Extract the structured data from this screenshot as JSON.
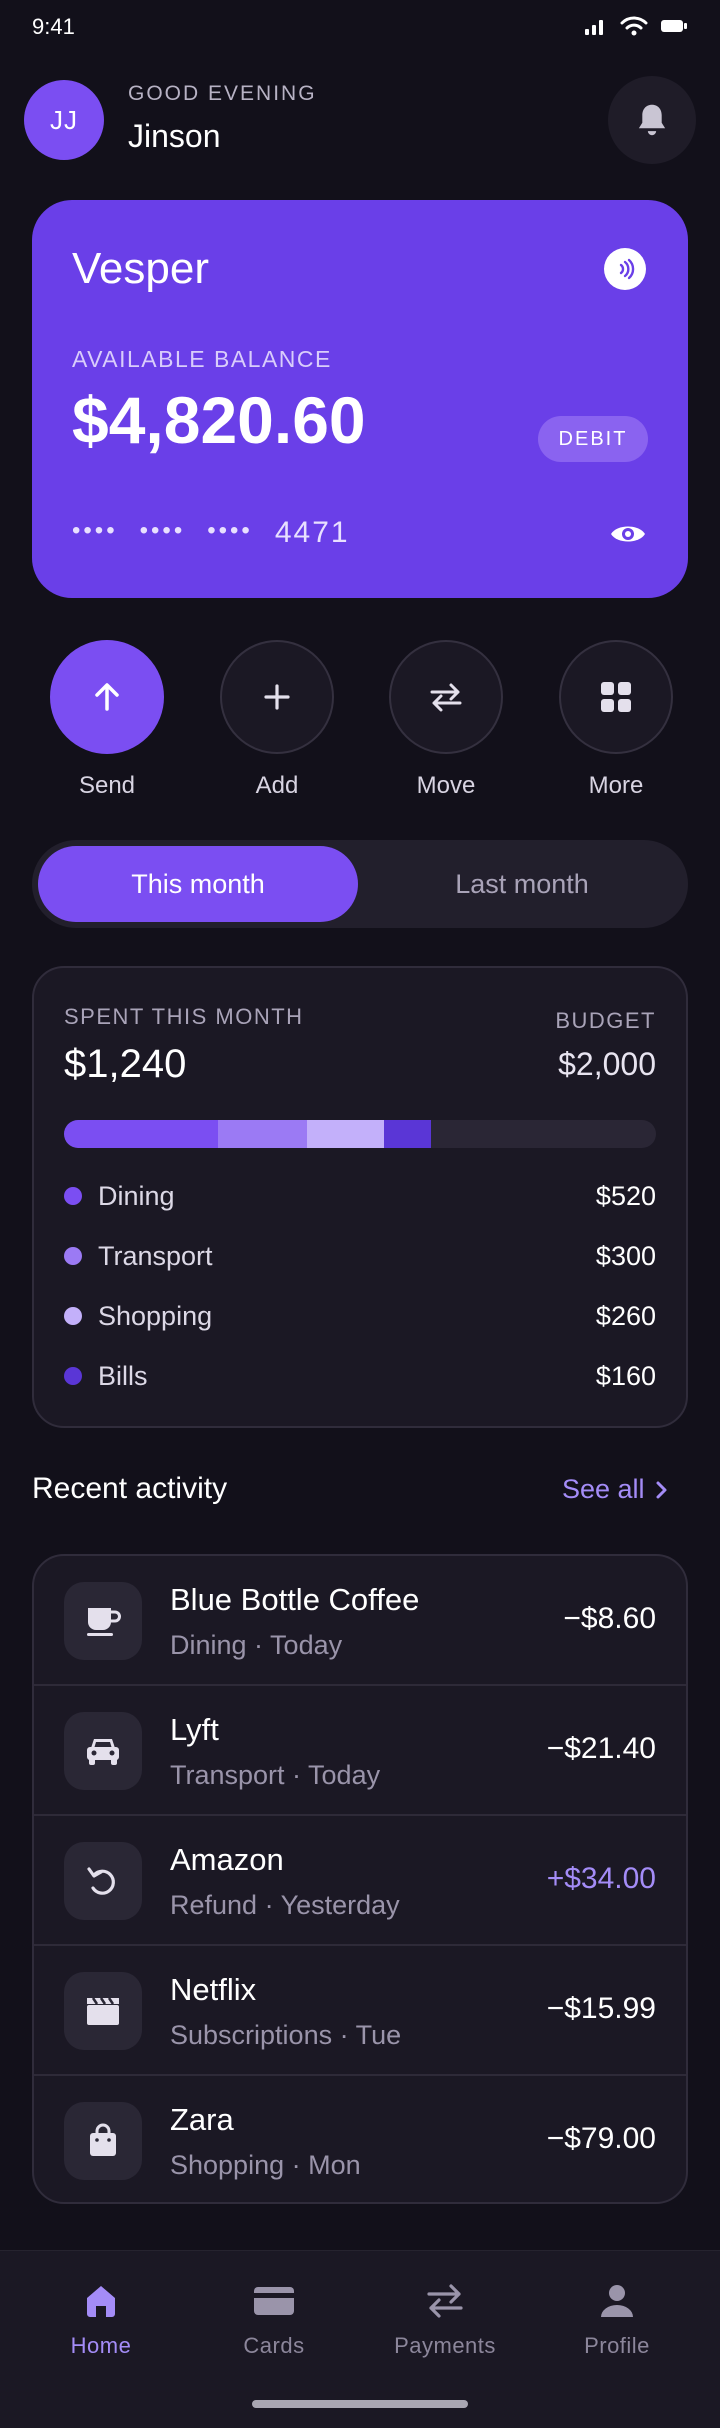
{
  "status_bar": {
    "time": "9:41"
  },
  "header": {
    "avatar_initials": "JJ",
    "greeting": "GOOD EVENING",
    "user_name": "Jinson"
  },
  "card": {
    "brand": "Vesper",
    "balance_label": "AVAILABLE BALANCE",
    "balance": "$4,820.60",
    "type_badge": "DEBIT",
    "masked_groups": [
      "••••",
      "••••",
      "••••"
    ],
    "last4": "4471",
    "accent_color": "#6a3fe8"
  },
  "actions": [
    {
      "label": "Send",
      "icon": "arrow-up-icon"
    },
    {
      "label": "Add",
      "icon": "plus-icon"
    },
    {
      "label": "Move",
      "icon": "swap-arrows-icon"
    },
    {
      "label": "More",
      "icon": "grid-icon"
    }
  ],
  "period_toggle": {
    "options": [
      "This month",
      "Last month"
    ],
    "selected": "This month"
  },
  "spending": {
    "spent_label": "SPENT THIS MONTH",
    "spent_value": "$1,240",
    "budget_label": "BUDGET",
    "budget_value": "$2,000",
    "spent_amount": 1240,
    "budget_amount": 2000,
    "categories": [
      {
        "name": "Dining",
        "amount_text": "$520",
        "amount": 520,
        "color": "#7b4ef2"
      },
      {
        "name": "Transport",
        "amount_text": "$300",
        "amount": 300,
        "color": "#9b7af4"
      },
      {
        "name": "Shopping",
        "amount_text": "$260",
        "amount": 260,
        "color": "#c3b0fa"
      },
      {
        "name": "Bills",
        "amount_text": "$160",
        "amount": 160,
        "color": "#5a36d6"
      }
    ]
  },
  "recent": {
    "title": "Recent activity",
    "see_all": "See all",
    "transactions": [
      {
        "name": "Blue Bottle Coffee",
        "meta": "Dining · Today",
        "amount": "−$8.60",
        "icon": "coffee-icon",
        "credit": false
      },
      {
        "name": "Lyft",
        "meta": "Transport · Today",
        "amount": "−$21.40",
        "icon": "car-icon",
        "credit": false
      },
      {
        "name": "Amazon",
        "meta": "Refund · Yesterday",
        "amount": "+$34.00",
        "icon": "refund-icon",
        "credit": true
      },
      {
        "name": "Netflix",
        "meta": "Subscriptions · Tue",
        "amount": "−$15.99",
        "icon": "clapperboard-icon",
        "credit": false
      },
      {
        "name": "Zara",
        "meta": "Shopping · Mon",
        "amount": "−$79.00",
        "icon": "shopping-bag-icon",
        "credit": false
      }
    ]
  },
  "bottom_nav": {
    "items": [
      {
        "label": "Home",
        "icon": "home-icon",
        "active": true
      },
      {
        "label": "Cards",
        "icon": "card-icon",
        "active": false
      },
      {
        "label": "Payments",
        "icon": "transfer-icon",
        "active": false
      },
      {
        "label": "Profile",
        "icon": "person-icon",
        "active": false
      }
    ]
  }
}
